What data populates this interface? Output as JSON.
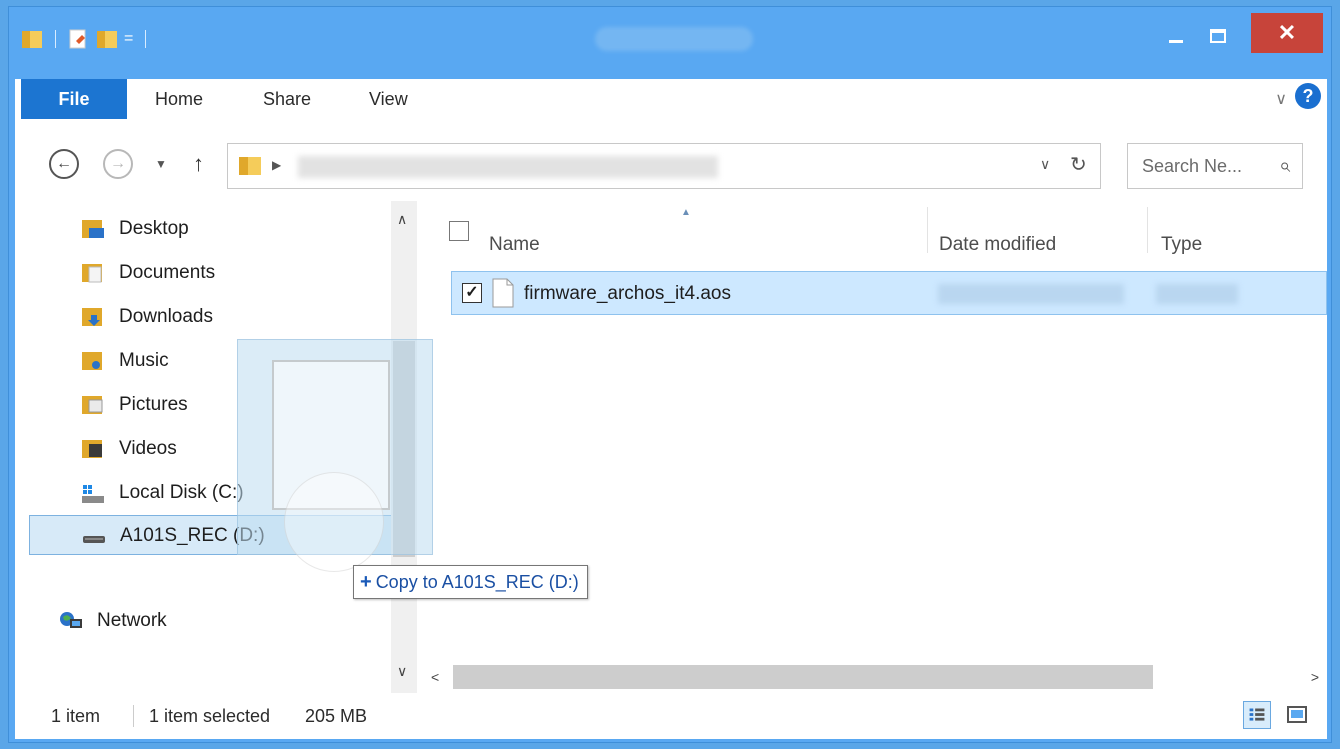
{
  "ribbon": {
    "tabs": [
      {
        "label": "File"
      },
      {
        "label": "Home"
      },
      {
        "label": "Share"
      },
      {
        "label": "View"
      }
    ],
    "help": "?"
  },
  "address": {
    "search_placeholder": "Search Ne..."
  },
  "navigation": {
    "items": [
      {
        "label": "Desktop",
        "icon": "desktop-folder-icon"
      },
      {
        "label": "Documents",
        "icon": "documents-folder-icon"
      },
      {
        "label": "Downloads",
        "icon": "downloads-folder-icon"
      },
      {
        "label": "Music",
        "icon": "music-folder-icon"
      },
      {
        "label": "Pictures",
        "icon": "pictures-folder-icon"
      },
      {
        "label": "Videos",
        "icon": "videos-folder-icon"
      },
      {
        "label": "Local Disk (C:)",
        "icon": "local-disk-icon"
      },
      {
        "label": "A101S_REC (D:)",
        "icon": "removable-drive-icon"
      },
      {
        "label": "Network",
        "icon": "network-icon"
      }
    ]
  },
  "columns": {
    "name": "Name",
    "date_modified": "Date modified",
    "type": "Type"
  },
  "files": [
    {
      "name": "firmware_archos_it4.aos",
      "selected": true
    }
  ],
  "drag": {
    "tooltip": "Copy to A101S_REC (D:)",
    "plus": "+"
  },
  "status": {
    "item_count": "1 item",
    "selection": "1 item selected",
    "size": "205 MB"
  },
  "colors": {
    "title_bar": "#59a8f2",
    "file_tab": "#1c75d1",
    "close_button": "#c7443a",
    "selection": "#cde8ff"
  }
}
